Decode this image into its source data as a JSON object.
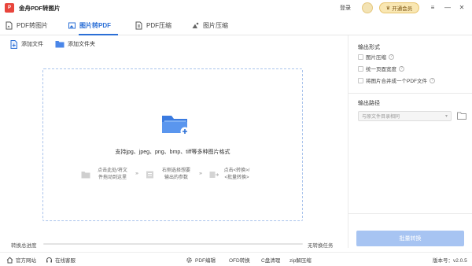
{
  "app": {
    "title": "金舟PDF转图片"
  },
  "titlebar": {
    "login_label": "登录",
    "vip_label": "开通会员",
    "crown": "♛"
  },
  "window_controls": {
    "menu": "≡",
    "minimize": "—",
    "close": "✕"
  },
  "tabs": [
    {
      "label": "PDF转图片",
      "icon": "pdf-to-image-icon",
      "active": false
    },
    {
      "label": "图片转PDF",
      "icon": "image-to-pdf-icon",
      "active": true
    },
    {
      "label": "PDF压缩",
      "icon": "pdf-compress-icon",
      "active": false
    },
    {
      "label": "图片压缩",
      "icon": "image-compress-icon",
      "active": false
    }
  ],
  "toolbar": {
    "add_file": "添加文件",
    "add_folder": "添加文件夹"
  },
  "dropzone": {
    "support_text": "支持jpg、jpeg、png、bmp、tiff等多种图片格式",
    "steps": [
      {
        "line1": "点击此处/将文",
        "line2": "件拖动到这里"
      },
      {
        "line1": "右侧选择想要",
        "line2": "输出的参数"
      },
      {
        "line1": "点击<转换>/",
        "line2": "<批量转换>"
      }
    ],
    "arrow": "›››"
  },
  "output_format": {
    "title": "输出形式",
    "options": [
      {
        "label": "图片压缩",
        "checked": false,
        "help": "?"
      },
      {
        "label": "统一页面宽度",
        "checked": false,
        "help": "?"
      },
      {
        "label": "将图片合并成一个PDF文件",
        "checked": false,
        "help": "?"
      }
    ]
  },
  "output_path": {
    "title": "输出路径",
    "value": "与原文件目录相同"
  },
  "convert_button": {
    "label": "批量转换"
  },
  "progress": {
    "label": "转换总进度",
    "status": "无转换任务",
    "value": 0
  },
  "footer": {
    "official_site": "官方网站",
    "online_service": "在线客服",
    "links": [
      "PDF编辑",
      "OFD转换",
      "C盘清理",
      "zip解压缩"
    ],
    "version": "版本号：v2.0.5"
  },
  "colors": {
    "accent": "#2b6fd6",
    "convert_button": "#a7c4f2",
    "vip_bg": "#f9e7b3",
    "logo": "#e8453c"
  }
}
